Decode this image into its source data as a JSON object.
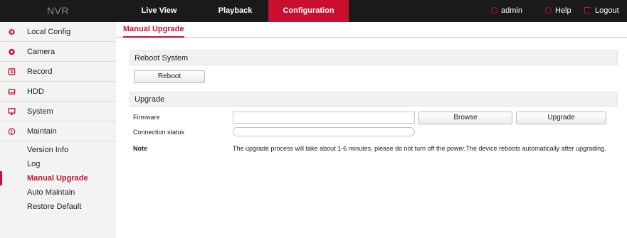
{
  "header": {
    "logo": "NVR",
    "nav": [
      "Live View",
      "Playback",
      "Configuration"
    ],
    "active_nav": "Configuration",
    "user": "admin",
    "help": "Help",
    "logout": "Logout",
    "accent_color": "#c8102e"
  },
  "sidebar": {
    "items": [
      {
        "label": "Local Config",
        "icon": "gear-icon"
      },
      {
        "label": "Camera",
        "icon": "camera-icon"
      },
      {
        "label": "Record",
        "icon": "record-icon"
      },
      {
        "label": "HDD",
        "icon": "hdd-icon"
      },
      {
        "label": "System",
        "icon": "monitor-icon"
      },
      {
        "label": "Maintain",
        "icon": "info-icon"
      }
    ],
    "sub_items": [
      "Version Info",
      "Log",
      "Manual Upgrade",
      "Auto Maintain",
      "Restore Default"
    ],
    "active_sub": "Manual Upgrade"
  },
  "main": {
    "tab": "Manual Upgrade",
    "reboot_section": {
      "title": "Reboot System",
      "button": "Reboot"
    },
    "upgrade_section": {
      "title": "Upgrade",
      "firmware_label": "Firmware",
      "firmware_value": "",
      "browse_button": "Browse",
      "upgrade_button": "Upgrade",
      "status_label": "Connection status",
      "note_label": "Note",
      "note_text": "The upgrade process will take about 1-6 minutes, please do not turn off the power,The device reboots automatically after upgrading."
    }
  }
}
